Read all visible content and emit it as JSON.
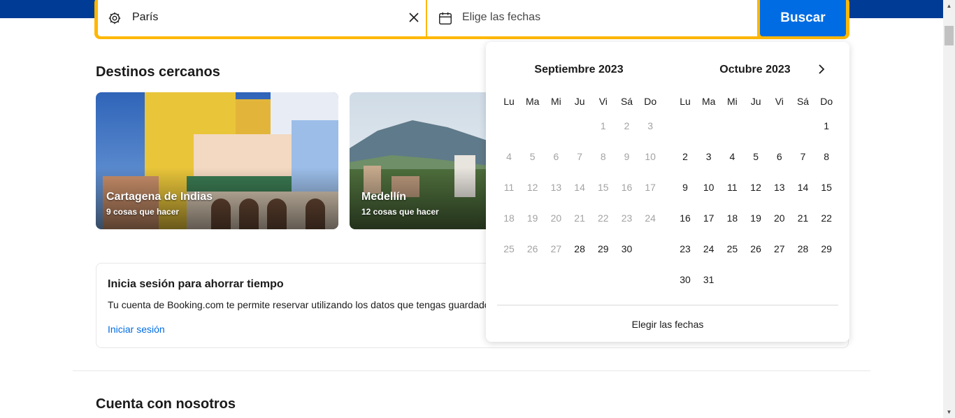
{
  "search": {
    "destination_value": "París",
    "dates_placeholder": "Elige las fechas",
    "button_label": "Buscar"
  },
  "sections": {
    "nearby_title": "Destinos cercanos",
    "trust_title": "Cuenta con nosotros"
  },
  "cards": [
    {
      "name": "Cartagena de Indias",
      "sub": "9 cosas que hacer"
    },
    {
      "name": "Medellín",
      "sub": "12 cosas que hacer"
    }
  ],
  "signin": {
    "title": "Inicia sesión para ahorrar tiempo",
    "text": "Tu cuenta de Booking.com te permite reservar utilizando los datos que tengas guardados",
    "link": "Iniciar sesión"
  },
  "calendar": {
    "weekdays": [
      "Lu",
      "Ma",
      "Mi",
      "Ju",
      "Vi",
      "Sá",
      "Do"
    ],
    "footer": "Elegir las fechas",
    "months": [
      {
        "title": "Septiembre 2023",
        "first_weekday_index": 4,
        "days": 30,
        "past_through": 27
      },
      {
        "title": "Octubre 2023",
        "first_weekday_index": 6,
        "days": 31,
        "past_through": 0
      }
    ]
  },
  "colors": {
    "brand_blue": "#003b95",
    "action_blue": "#006ce4",
    "search_yellow": "#ffb700"
  }
}
